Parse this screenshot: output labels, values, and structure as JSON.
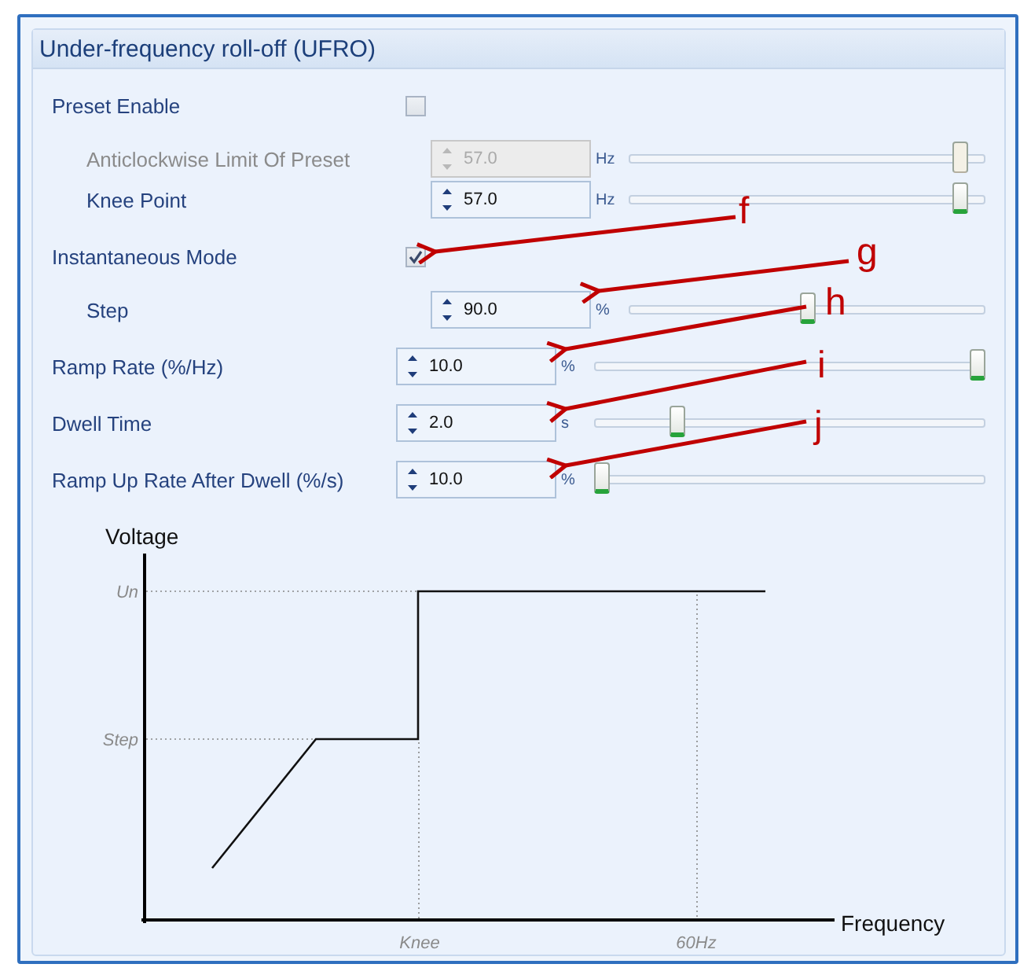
{
  "panel": {
    "title": "Under-frequency roll-off (UFRO)"
  },
  "rows": [
    {
      "kind": "checkbox",
      "label": "Preset Enable",
      "checked": false,
      "children": [
        {
          "kind": "spinner",
          "label": "Anticlockwise Limit Of Preset",
          "value": "57.0",
          "unit": "Hz",
          "level": 0.95,
          "disabled": true
        },
        {
          "kind": "spinner",
          "label": "Knee Point",
          "value": "57.0",
          "unit": "Hz",
          "level": 0.95,
          "disabled": false
        }
      ]
    },
    {
      "kind": "checkbox",
      "label": "Instantaneous Mode",
      "checked": true,
      "children": [
        {
          "kind": "spinner",
          "label": "Step",
          "value": "90.0",
          "unit": "%",
          "level": 0.5,
          "disabled": false
        }
      ]
    },
    {
      "kind": "spinner",
      "label": "Ramp Rate (%/Hz)",
      "value": "10.0",
      "unit": "%",
      "level": 1,
      "disabled": false
    },
    {
      "kind": "spinner",
      "label": "Dwell Time",
      "value": "2.0",
      "unit": "s",
      "level": 0.2,
      "disabled": false
    },
    {
      "kind": "spinner",
      "label": "Ramp Up Rate After Dwell (%/s)",
      "value": "10.0",
      "unit": "%",
      "level": 0,
      "disabled": false
    }
  ],
  "diagram": {
    "y_axis_label": "Voltage",
    "x_axis_label": "Frequency",
    "y_marks": [
      "Un",
      "Step"
    ],
    "x_marks": [
      "Knee",
      "60Hz"
    ]
  },
  "callouts": [
    {
      "label": "f"
    },
    {
      "label": "g"
    },
    {
      "label": "h"
    },
    {
      "label": "i"
    },
    {
      "label": "j"
    }
  ]
}
